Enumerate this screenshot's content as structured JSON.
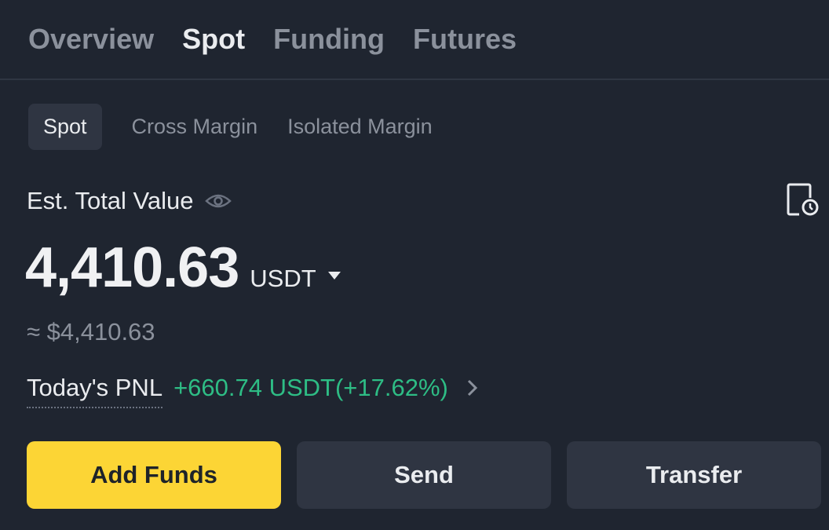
{
  "top_tabs": [
    {
      "label": "Overview",
      "active": false
    },
    {
      "label": "Spot",
      "active": true
    },
    {
      "label": "Funding",
      "active": false
    },
    {
      "label": "Futures",
      "active": false
    }
  ],
  "sub_tabs": [
    {
      "label": "Spot",
      "active": true
    },
    {
      "label": "Cross Margin",
      "active": false
    },
    {
      "label": "Isolated Margin",
      "active": false
    }
  ],
  "balance": {
    "label": "Est. Total Value",
    "value": "4,410.63",
    "unit": "USDT",
    "approx": "≈ $4,410.63"
  },
  "pnl": {
    "label": "Today's PNL",
    "value": "+660.74 USDT(+17.62%)"
  },
  "actions": {
    "add_funds": "Add Funds",
    "send": "Send",
    "transfer": "Transfer"
  },
  "icons": {
    "eye": "eye-icon",
    "history": "history-icon",
    "caret": "caret-down-icon",
    "chevron": "chevron-right-icon"
  },
  "colors": {
    "background": "#1f2530",
    "accent": "#fcd535",
    "positive": "#2ebd85",
    "muted": "#8b919c"
  }
}
